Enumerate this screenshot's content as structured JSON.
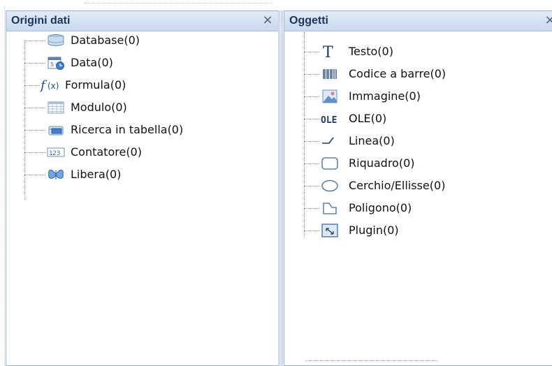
{
  "panels": {
    "data_sources": {
      "title": "Origini dati",
      "close_glyph": "×",
      "items": [
        {
          "label": "Database(0)",
          "icon": "database-icon"
        },
        {
          "label": "Data(0)",
          "icon": "calendar-icon"
        },
        {
          "label": "Formula(0)",
          "icon": "formula-icon"
        },
        {
          "label": "Modulo(0)",
          "icon": "form-grid-icon"
        },
        {
          "label": "Ricerca in tabella(0)",
          "icon": "table-lookup-icon"
        },
        {
          "label": "Contatore(0)",
          "icon": "counter-icon"
        },
        {
          "label": "Libera(0)",
          "icon": "butterfly-icon"
        }
      ]
    },
    "objects": {
      "title": "Oggetti",
      "close_glyph": "×",
      "items": [
        {
          "label": "Testo(0)",
          "icon": "text-icon"
        },
        {
          "label": "Codice a barre(0)",
          "icon": "barcode-icon"
        },
        {
          "label": "Immagine(0)",
          "icon": "image-icon"
        },
        {
          "label": "OLE(0)",
          "icon": "ole-icon"
        },
        {
          "label": "Linea(0)",
          "icon": "line-icon"
        },
        {
          "label": "Riquadro(0)",
          "icon": "rectangle-icon"
        },
        {
          "label": "Cerchio/Ellisse(0)",
          "icon": "ellipse-icon"
        },
        {
          "label": "Poligono(0)",
          "icon": "polygon-icon"
        },
        {
          "label": "Plugin(0)",
          "icon": "plugin-icon"
        }
      ]
    }
  },
  "colors": {
    "header_gradient_top": "#e2ebf7",
    "header_gradient_bottom": "#c8d8ee",
    "title_text": "#17365d",
    "panel_border": "#9fb3cf"
  }
}
